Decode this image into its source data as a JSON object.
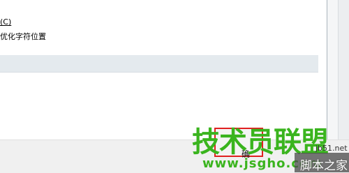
{
  "options": {
    "line1_text": "(C)",
    "line2_text": "优化字符位置"
  },
  "footer": {
    "ok_label": "确"
  },
  "watermark": {
    "logo_text": "技术员联盟",
    "url_text": "www.jsgho.com",
    "side_text1": "jb51.net",
    "side_text2": "脚本之家"
  },
  "colors": {
    "watermark_green": "#3ab41e",
    "highlight_red": "#e02020",
    "band_gray": "#e4eaee"
  }
}
